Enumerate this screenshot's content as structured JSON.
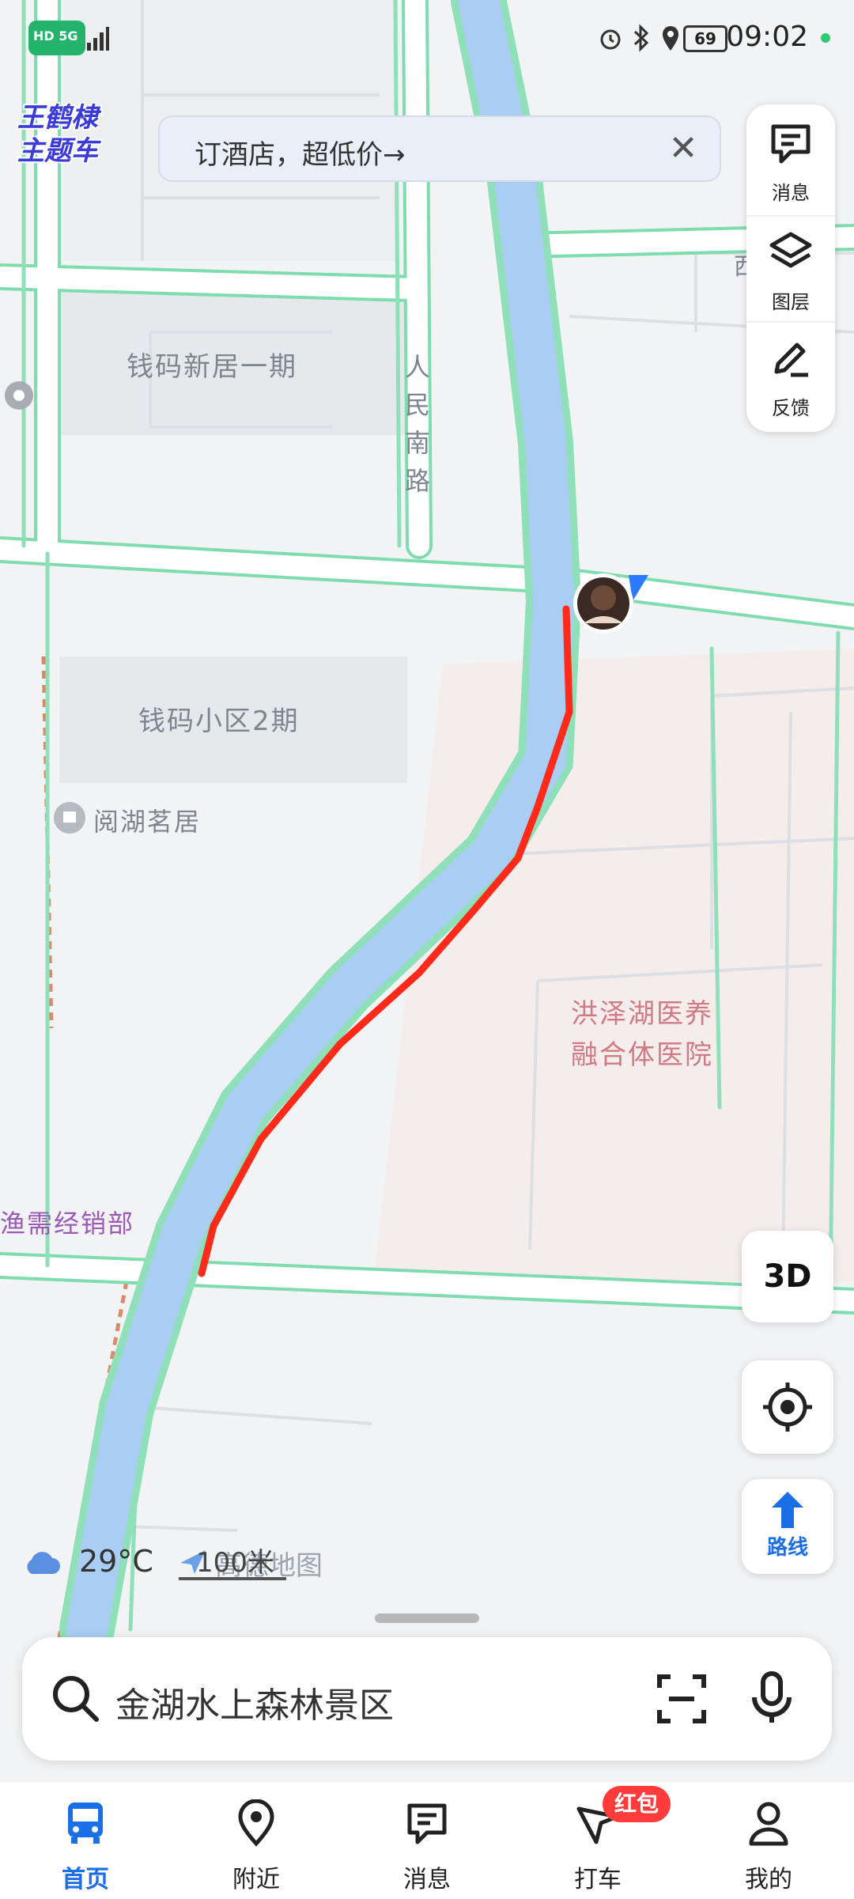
{
  "status_bar": {
    "time": "09:02",
    "battery": "69",
    "network": "HD 5G"
  },
  "theme": {
    "line1": "王鹤棣",
    "line2": "主题车"
  },
  "banner": {
    "text": "订酒店，超低价→",
    "close": "✕"
  },
  "tools": {
    "messages_label": "消息",
    "layers_label": "图层",
    "feedback_label": "反馈"
  },
  "map_labels": {
    "qianma_xinju": "钱码新居一期",
    "renmin_road": "人民南路",
    "qianma_xiaoqu": "钱码小区2期",
    "yuehu_mingju": "阅湖茗居",
    "hospital_line1": "洪泽湖医养",
    "hospital_line2": "融合体医院",
    "yuxu_shop": "渔需经销部",
    "cut_label": "西"
  },
  "controls": {
    "three_d": "3D",
    "route_label": "路线"
  },
  "weather": {
    "temperature": "29°C"
  },
  "map_info": {
    "scale": "100米",
    "provider": "高德地图"
  },
  "search": {
    "query": "金湖水上森林景区"
  },
  "bottom_nav": {
    "home": "首页",
    "nearby": "附近",
    "messages": "消息",
    "taxi": "打车",
    "mine": "我的",
    "taxi_badge": "红包"
  },
  "colors": {
    "accent": "#1a6fe6",
    "route": "#ff2a1a",
    "river": "#a9cdf3",
    "road_edge": "#7fdcae",
    "hospital_area": "#f5ecec",
    "badge": "#ff3b3b"
  }
}
